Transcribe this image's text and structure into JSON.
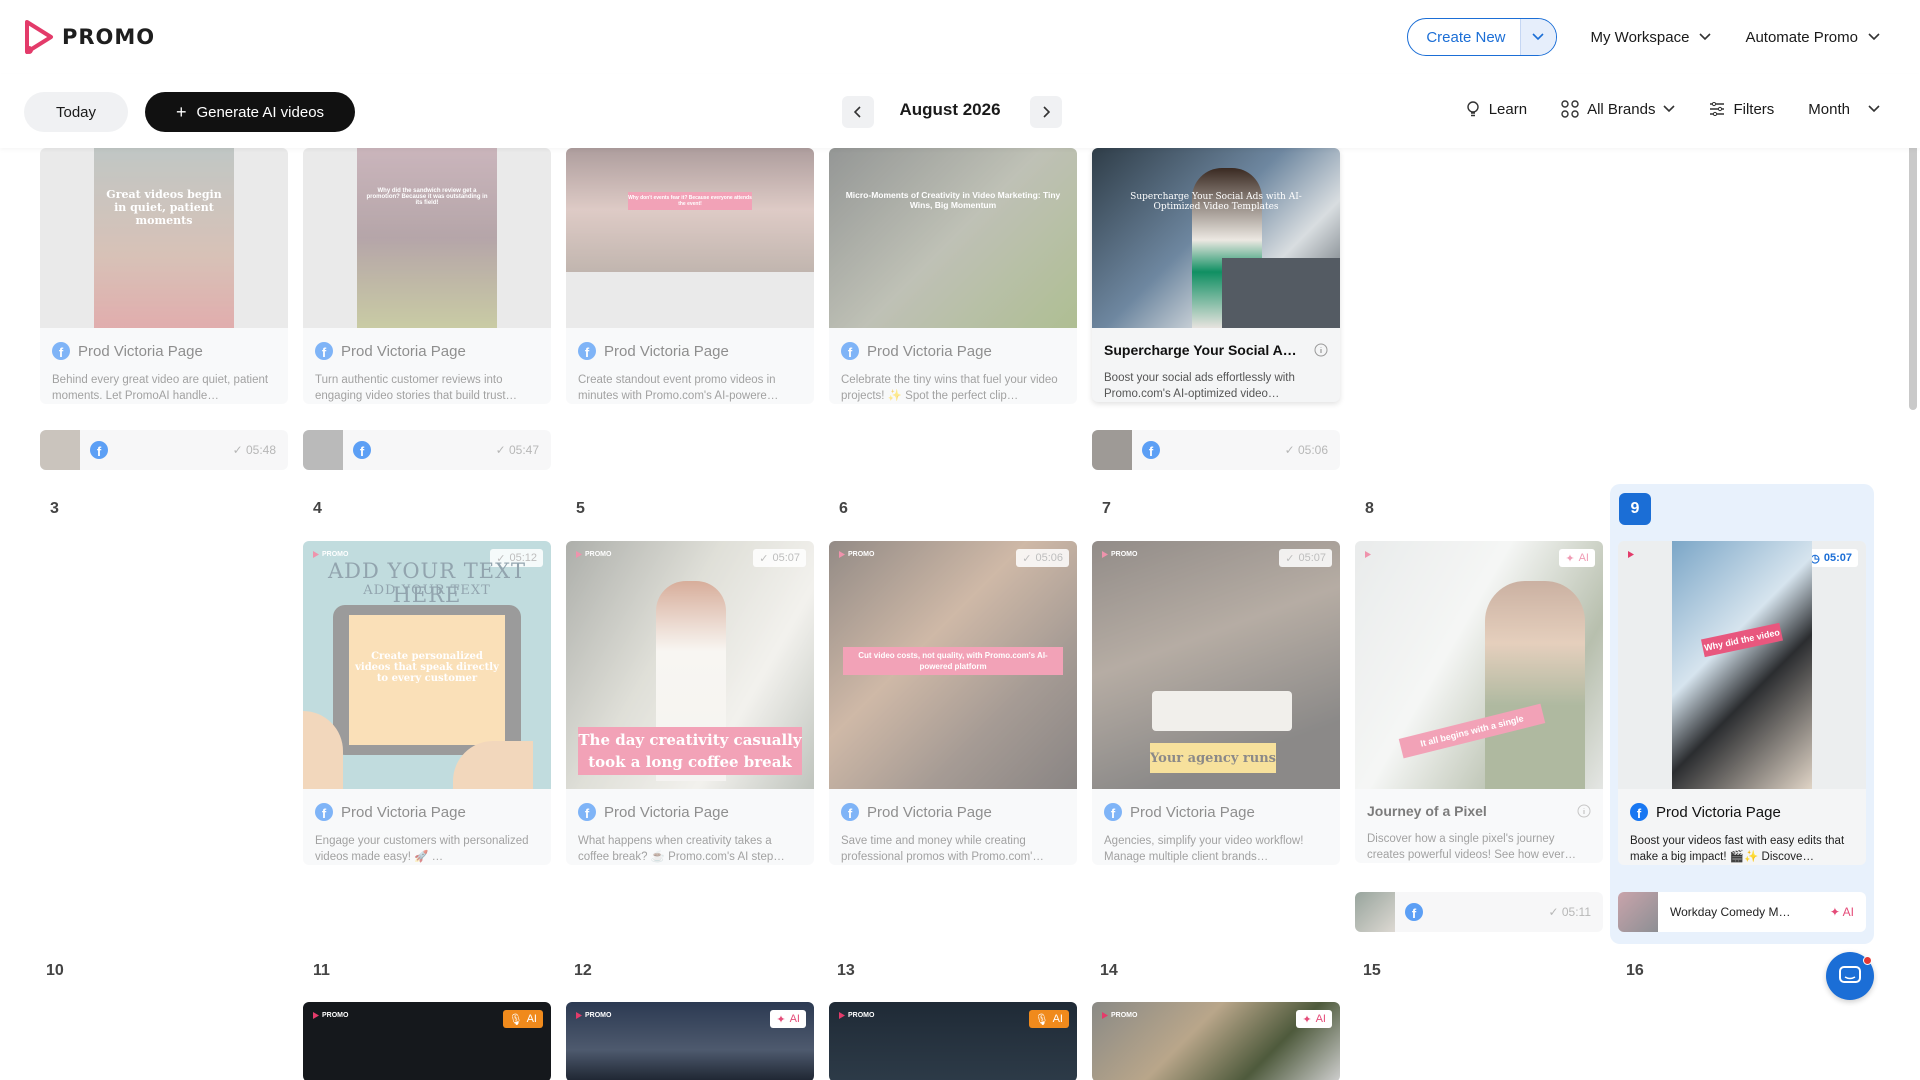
{
  "app": {
    "brand": "PROMO"
  },
  "header": {
    "create_new": "Create New",
    "workspace": "My Workspace",
    "automate": "Automate Promo"
  },
  "toolbar": {
    "today": "Today",
    "generate": "Generate AI videos",
    "month": "August 2026",
    "learn": "Learn",
    "brands": "All Brands",
    "filters": "Filters",
    "view": "Month"
  },
  "week1": {
    "cards": [
      {
        "page": "Prod Victoria Page",
        "desc": "Behind every great video are quiet, patient moments. Let PromoAI handle…",
        "overlay": "Great videos begin in quiet, patient moments",
        "sched_time": "05:48"
      },
      {
        "page": "Prod Victoria Page",
        "desc": "Turn authentic customer reviews into engaging video stories that build trust…",
        "overlay": "Why did the sandwich review get a promotion? Because it was outstanding in its field!",
        "sched_time": "05:47"
      },
      {
        "page": "Prod Victoria Page",
        "desc": "Create standout event promo videos in minutes with Promo.com's AI-powere…",
        "overlay": "Why don't events fear it? Because everyone attends the event!"
      },
      {
        "page": "Prod Victoria Page",
        "desc": "Celebrate the tiny wins that fuel your video projects! ✨ Spot the perfect clip…",
        "overlay": "Micro-Moments of Creativity in Video Marketing: Tiny Wins, Big Momentum"
      },
      {
        "title": "Supercharge Your Social A…",
        "desc": "Boost your social ads effortlessly with Promo.com's AI-optimized video…",
        "overlay": "Supercharge Your Social Ads with AI-Optimized Video Templates",
        "sched_time": "05:06"
      }
    ]
  },
  "week2": {
    "days": [
      "3",
      "4",
      "5",
      "6",
      "7",
      "8",
      "9"
    ],
    "cards": [
      {
        "page": "Prod Victoria Page",
        "desc": "Engage your customers with personalized videos made easy! 🚀 …",
        "time": "05:12",
        "overlay_top": "ADD YOUR TEXT HERE",
        "overlay_sub": "ADD YOUR TEXT",
        "overlay": "Create personalized videos that speak directly to every customer"
      },
      {
        "page": "Prod Victoria Page",
        "desc": "What happens when creativity takes a coffee break? ☕ Promo.com's AI step…",
        "time": "05:07",
        "overlay": "The day creativity casually took a long coffee break"
      },
      {
        "page": "Prod Victoria Page",
        "desc": "Save time and money while creating professional promos with Promo.com'…",
        "time": "05:06",
        "overlay": "Cut video costs, not quality, with Promo.com's AI-powered platform"
      },
      {
        "page": "Prod Victoria Page",
        "desc": "Agencies, simplify your video workflow! Manage multiple client brands…",
        "time": "05:07",
        "overlay": "Your agency runs"
      },
      {
        "title": "Journey of a Pixel",
        "desc": "Discover how a single pixel's journey creates powerful videos! See how ever…",
        "badge": "AI",
        "overlay": "It all begins with a single",
        "sched_time": "05:11"
      },
      {
        "page": "Prod Victoria Page",
        "desc": "Boost your videos fast with easy edits that make a big impact! 🎬✨ Discove…",
        "time": "05:07",
        "overlay": "Why did the video",
        "sched_title": "Workday Comedy M…",
        "sched_badge": "AI"
      }
    ]
  },
  "week3": {
    "days": [
      "10",
      "11",
      "12",
      "13",
      "14",
      "15",
      "16"
    ],
    "badges": [
      "AI",
      "AI",
      "AI",
      "AI"
    ]
  },
  "promo_small": "PROMO",
  "colors": {
    "accent": "#1b6ed6",
    "brand": "#e33b6a",
    "ai_orange": "#f08a1c",
    "ai_pink": "#e44b78"
  }
}
